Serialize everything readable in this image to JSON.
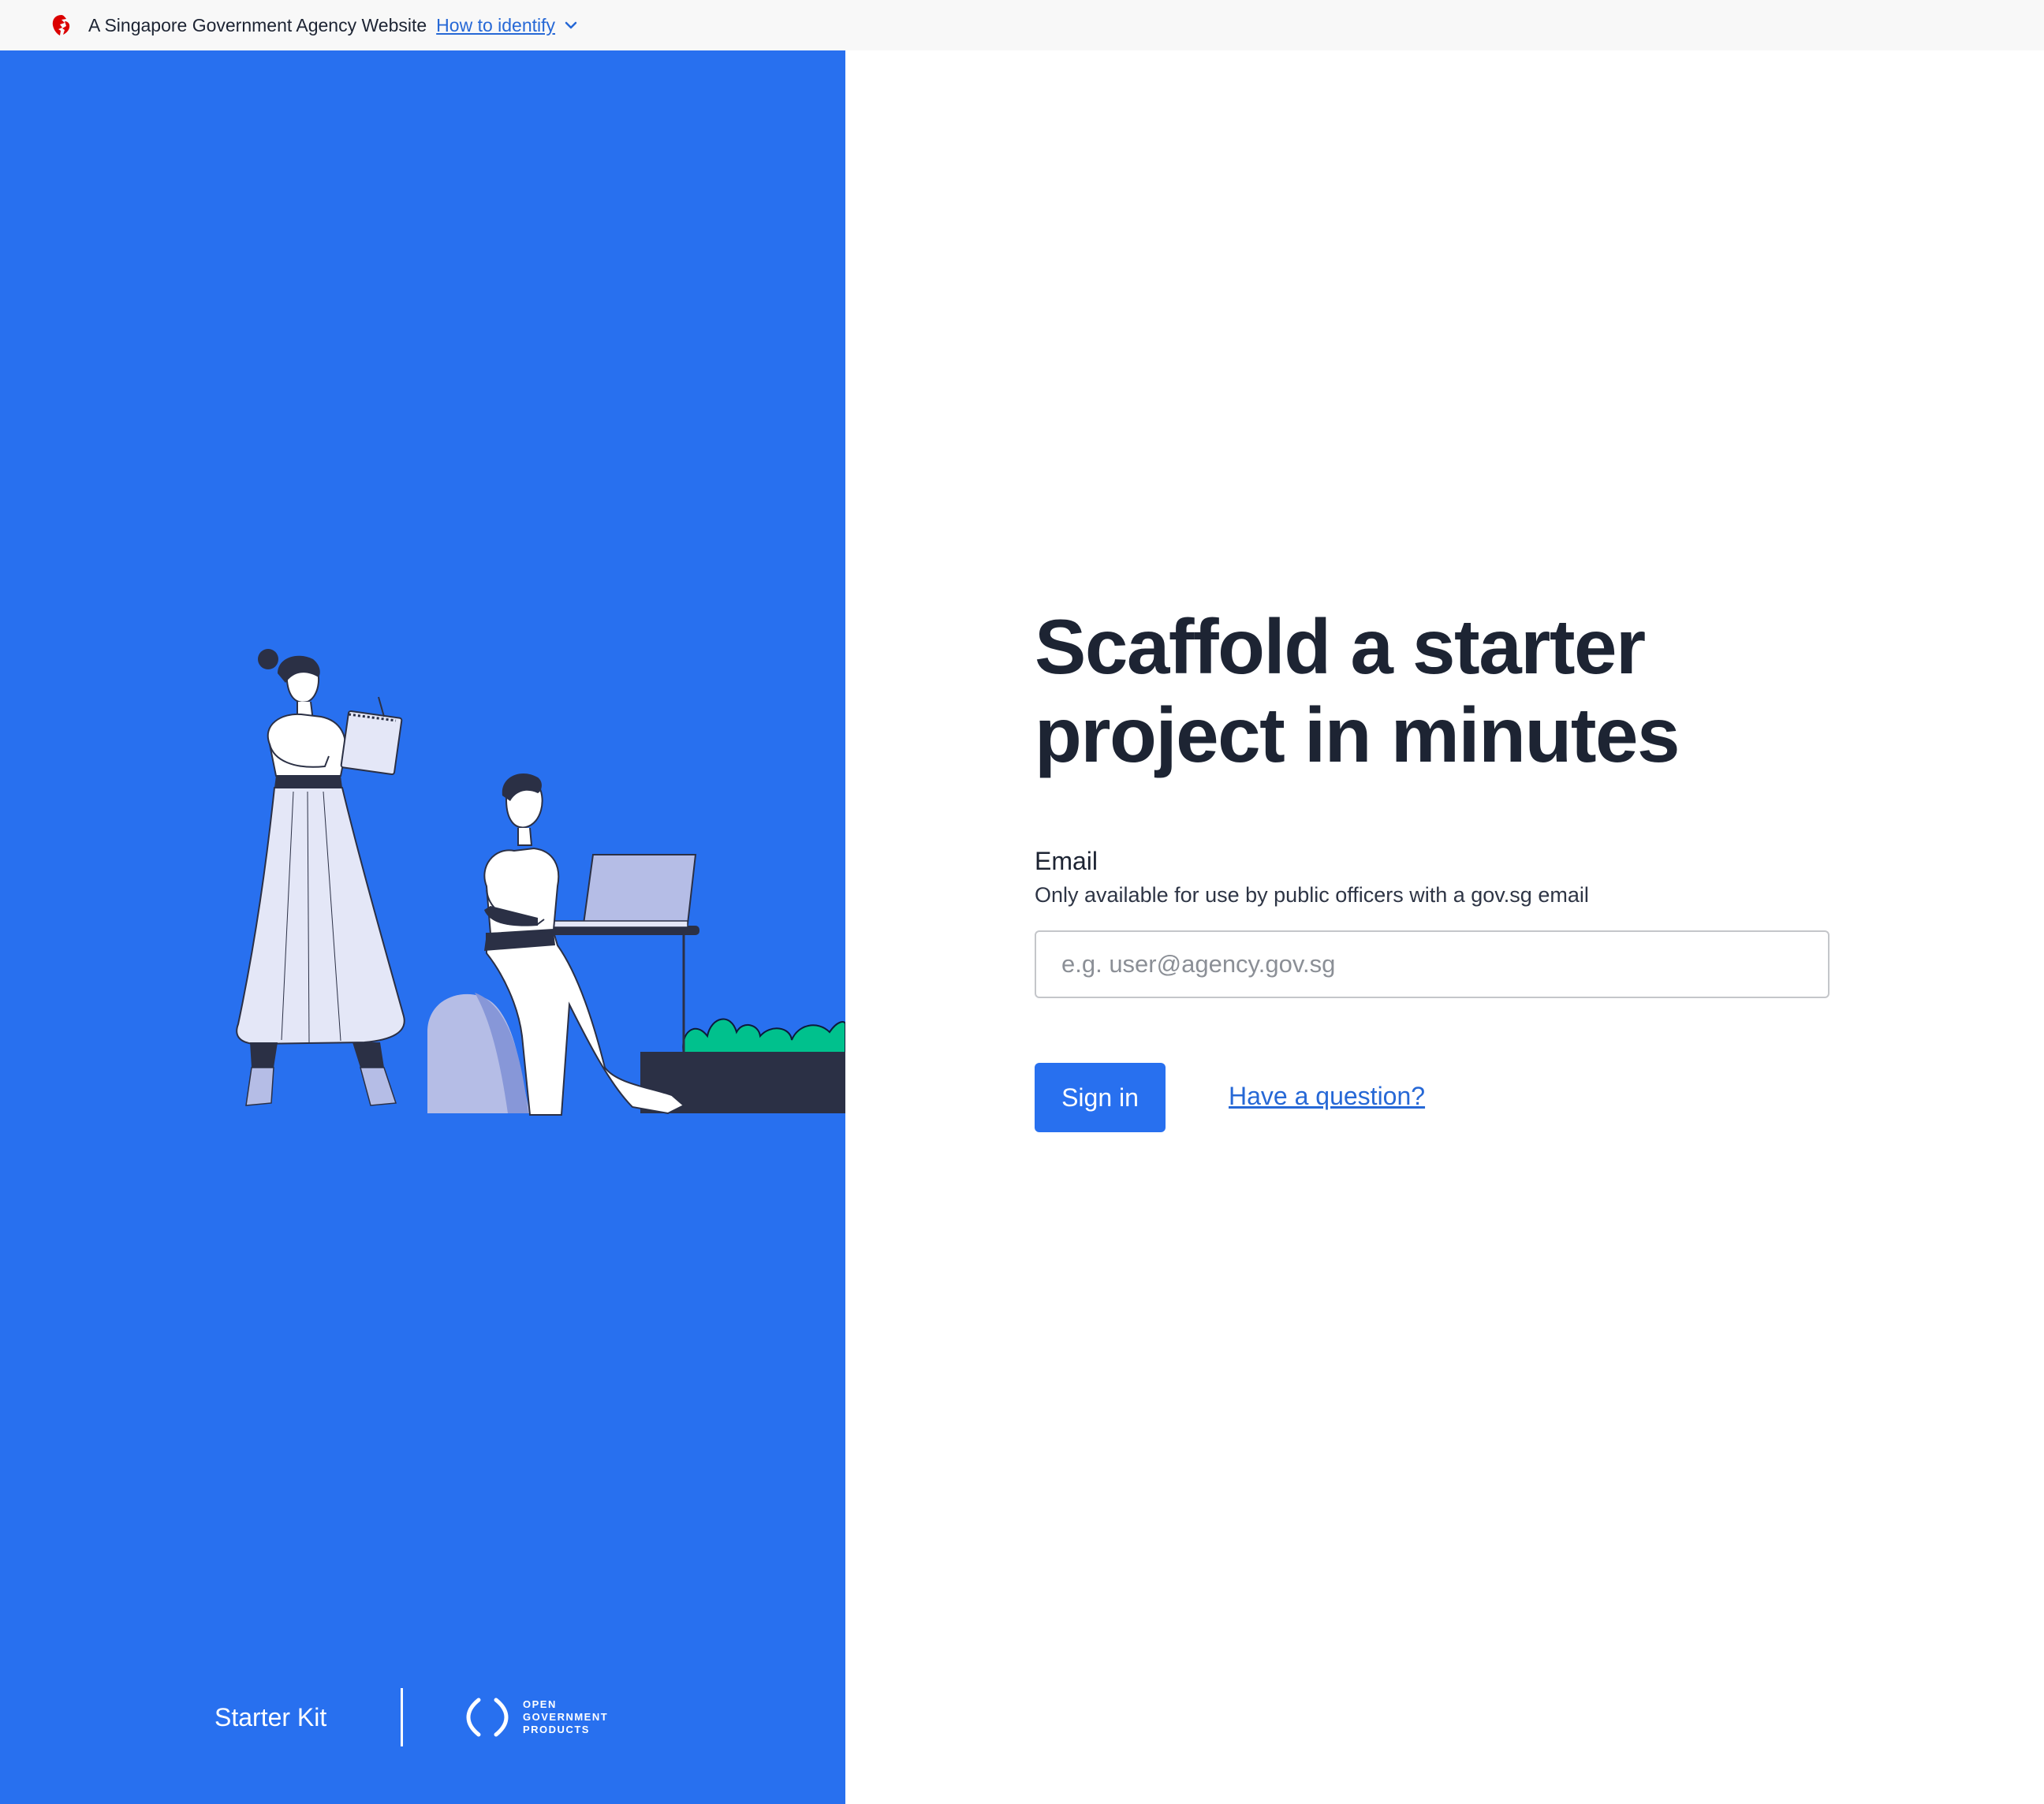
{
  "masthead": {
    "gov_text": "A Singapore Government Agency Website",
    "identify_link": "How to identify",
    "icons": [
      "lion-head-icon",
      "chevron-down-icon"
    ]
  },
  "hero": {
    "illustration": "illustration-people-working",
    "brand_name": "Starter Kit",
    "ogp_logo_lines": [
      "OPEN",
      "GOVERNMENT",
      "PRODUCTS"
    ]
  },
  "login": {
    "headline": "Scaffold a starter project in minutes",
    "email_label": "Email",
    "email_help": "Only available for use by public officers with a gov.sg email",
    "email_value": "",
    "email_placeholder": "e.g. user@agency.gov.sg",
    "signin_label": "Sign in",
    "question_link": "Have a question?"
  },
  "colors": {
    "brand_blue": "#2870ef",
    "link_blue": "#2668d6",
    "text_dark": "#1d2433",
    "plant_green": "#00c18d",
    "masthead_bg": "#f8f8f8"
  }
}
